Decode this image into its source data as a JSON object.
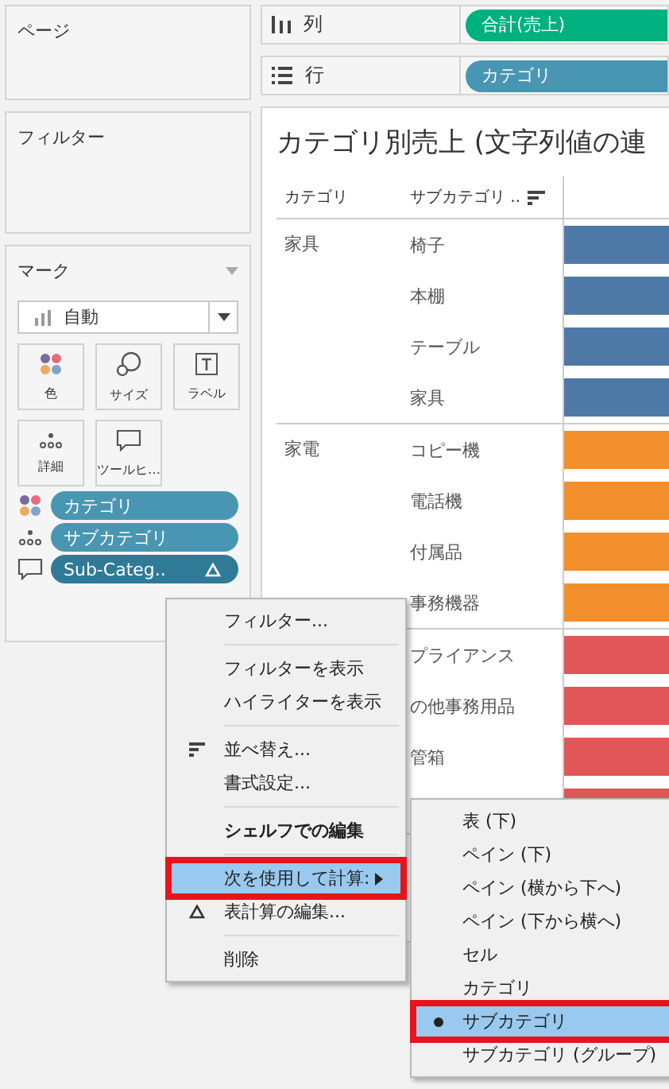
{
  "pages_card": {
    "title": "ページ"
  },
  "filters_card": {
    "title": "フィルター"
  },
  "marks_card": {
    "title": "マーク",
    "mark_type": "自動",
    "buttons": [
      {
        "kind": "color",
        "label": "色"
      },
      {
        "kind": "size",
        "label": "サイズ"
      },
      {
        "kind": "label",
        "label": "ラベル"
      },
      {
        "kind": "detail",
        "label": "詳細"
      },
      {
        "kind": "tooltip",
        "label": "ツールヒ…"
      }
    ],
    "fields": [
      {
        "kind": "color",
        "label": "カテゴリ",
        "table_calc": false
      },
      {
        "kind": "detail",
        "label": "サブカテゴリ",
        "table_calc": false
      },
      {
        "kind": "tooltip",
        "label": "Sub-Categ..",
        "table_calc": true
      }
    ]
  },
  "columns_shelf": {
    "label": "列",
    "pill": "合計(売上)"
  },
  "rows_shelf": {
    "label": "行",
    "pill": "カテゴリ"
  },
  "viz": {
    "title": "カテゴリ別売上 (文字列値の連",
    "headers": [
      "カテゴリ",
      "サブカテゴリ .."
    ],
    "groups": [
      {
        "category": "家具",
        "color": "#4e79a7",
        "rows": [
          "椅子",
          "本棚",
          "テーブル",
          "家具"
        ]
      },
      {
        "category": "家電",
        "color": "#f28e2b",
        "rows": [
          "コピー機",
          "電話機",
          "付属品",
          "事務機器"
        ]
      },
      {
        "color": "#e15759",
        "rows": [
          "プライアンス",
          "の他事務用品",
          "管箱",
          ""
        ]
      }
    ]
  },
  "context_menu": {
    "items": [
      {
        "kind": "plain",
        "label": "フィルター...",
        "selected": false,
        "marked": false
      },
      {
        "kind": "separator"
      },
      {
        "kind": "plain",
        "label": "フィルターを表示",
        "selected": false,
        "marked": false
      },
      {
        "kind": "plain",
        "label": "ハイライターを表示",
        "selected": false,
        "marked": false
      },
      {
        "kind": "separator"
      },
      {
        "kind": "sort",
        "label": "並べ替え...",
        "selected": false,
        "marked": false
      },
      {
        "kind": "plain",
        "label": "書式設定...",
        "selected": false,
        "marked": false
      },
      {
        "kind": "separator"
      },
      {
        "kind": "heading",
        "label": "シェルフでの編集",
        "selected": false,
        "marked": false
      },
      {
        "kind": "separator"
      },
      {
        "kind": "cascade",
        "label": "次を使用して計算:",
        "selected": true,
        "marked": true
      },
      {
        "kind": "delta",
        "label": "表計算の編集...",
        "selected": false,
        "marked": false
      },
      {
        "kind": "separator"
      },
      {
        "kind": "plain",
        "label": "削除",
        "selected": false,
        "marked": false
      }
    ]
  },
  "submenu": {
    "items": [
      {
        "label": "表 (下)",
        "selected": false,
        "marked": false
      },
      {
        "label": "ペイン (下)",
        "selected": false,
        "marked": false
      },
      {
        "label": "ペイン (横から下へ)",
        "selected": false,
        "marked": false
      },
      {
        "label": "ペイン (下から横へ)",
        "selected": false,
        "marked": false
      },
      {
        "label": "セル",
        "selected": false,
        "marked": false
      },
      {
        "label": "カテゴリ",
        "selected": false,
        "marked": false
      },
      {
        "label": "サブカテゴリ",
        "selected": true,
        "marked": true
      },
      {
        "label": "サブカテゴリ (グループ)",
        "selected": false,
        "marked": false
      }
    ]
  }
}
